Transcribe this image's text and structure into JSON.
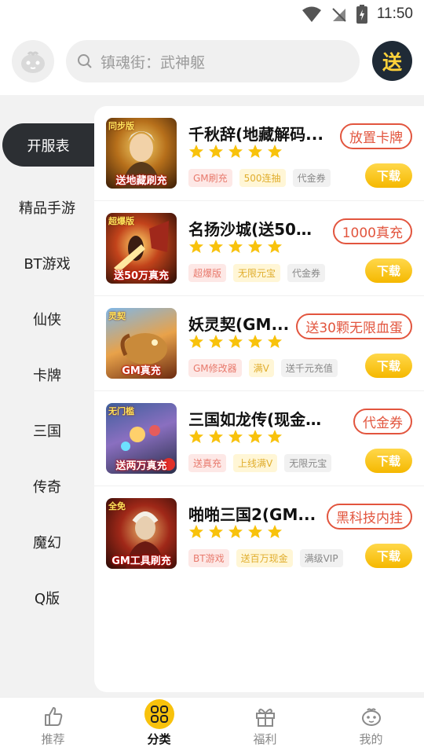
{
  "status": {
    "time": "11:50"
  },
  "search": {
    "placeholder": "镇魂街：武神躯"
  },
  "send_button": {
    "label": "送"
  },
  "sidebar": {
    "items": [
      {
        "label": "开服表"
      },
      {
        "label": "精品手游"
      },
      {
        "label": "BT游戏"
      },
      {
        "label": "仙侠"
      },
      {
        "label": "卡牌"
      },
      {
        "label": "三国"
      },
      {
        "label": "传奇"
      },
      {
        "label": "魔幻"
      },
      {
        "label": "Q版"
      }
    ],
    "active_index": 0
  },
  "games": [
    {
      "name": "千秋辞(地藏解码...",
      "rating": 5,
      "promo": "放置卡牌",
      "download": "下载",
      "thumb_badge": "同步版",
      "thumb_caption": "送地藏刷充",
      "tags": [
        {
          "text": "GM刷充",
          "style": "red"
        },
        {
          "text": "500连抽",
          "style": "yellow"
        },
        {
          "text": "代金券",
          "style": "gray"
        }
      ]
    },
    {
      "name": "名扬沙城(送50万...",
      "rating": 5,
      "promo": "1000真充",
      "download": "下载",
      "thumb_badge": "超爆版",
      "thumb_caption": "送50万真充",
      "tags": [
        {
          "text": "超爆版",
          "style": "red"
        },
        {
          "text": "无限元宝",
          "style": "yellow"
        },
        {
          "text": "代金券",
          "style": "gray"
        }
      ]
    },
    {
      "name": "妖灵契(GM...",
      "rating": 5,
      "promo": "送30颗无限血蛋",
      "download": "下载",
      "thumb_badge": "灵契",
      "thumb_caption": "GM真充",
      "tags": [
        {
          "text": "GM修改器",
          "style": "red"
        },
        {
          "text": "满V",
          "style": "yellow"
        },
        {
          "text": "送千元充值",
          "style": "gray"
        }
      ]
    },
    {
      "name": "三国如龙传(现金点...",
      "rating": 5,
      "promo": "代金券",
      "download": "下载",
      "thumb_badge": "无门槛",
      "thumb_caption": "送两万真充",
      "tags": [
        {
          "text": "送真充",
          "style": "red"
        },
        {
          "text": "上线满V",
          "style": "yellow"
        },
        {
          "text": "无限元宝",
          "style": "gray"
        }
      ]
    },
    {
      "name": "啪啪三国2(GM...",
      "rating": 5,
      "promo": "黑科技内挂",
      "download": "下载",
      "thumb_badge": "全免",
      "thumb_caption": "GM工具刷充",
      "tags": [
        {
          "text": "BT游戏",
          "style": "red"
        },
        {
          "text": "送百万现金",
          "style": "yellow"
        },
        {
          "text": "满级VIP",
          "style": "gray"
        }
      ]
    }
  ],
  "bottom_nav": [
    {
      "label": "推荐",
      "icon": "thumbs-up-icon"
    },
    {
      "label": "分类",
      "icon": "grid-icon"
    },
    {
      "label": "福利",
      "icon": "gift-icon"
    },
    {
      "label": "我的",
      "icon": "mascot-icon"
    }
  ],
  "bottom_nav_active": 1,
  "colors": {
    "accent": "#f8c20c",
    "promo": "#e2553e",
    "sidebar_active": "#2c2f33",
    "send_bg": "#1f2a36"
  }
}
